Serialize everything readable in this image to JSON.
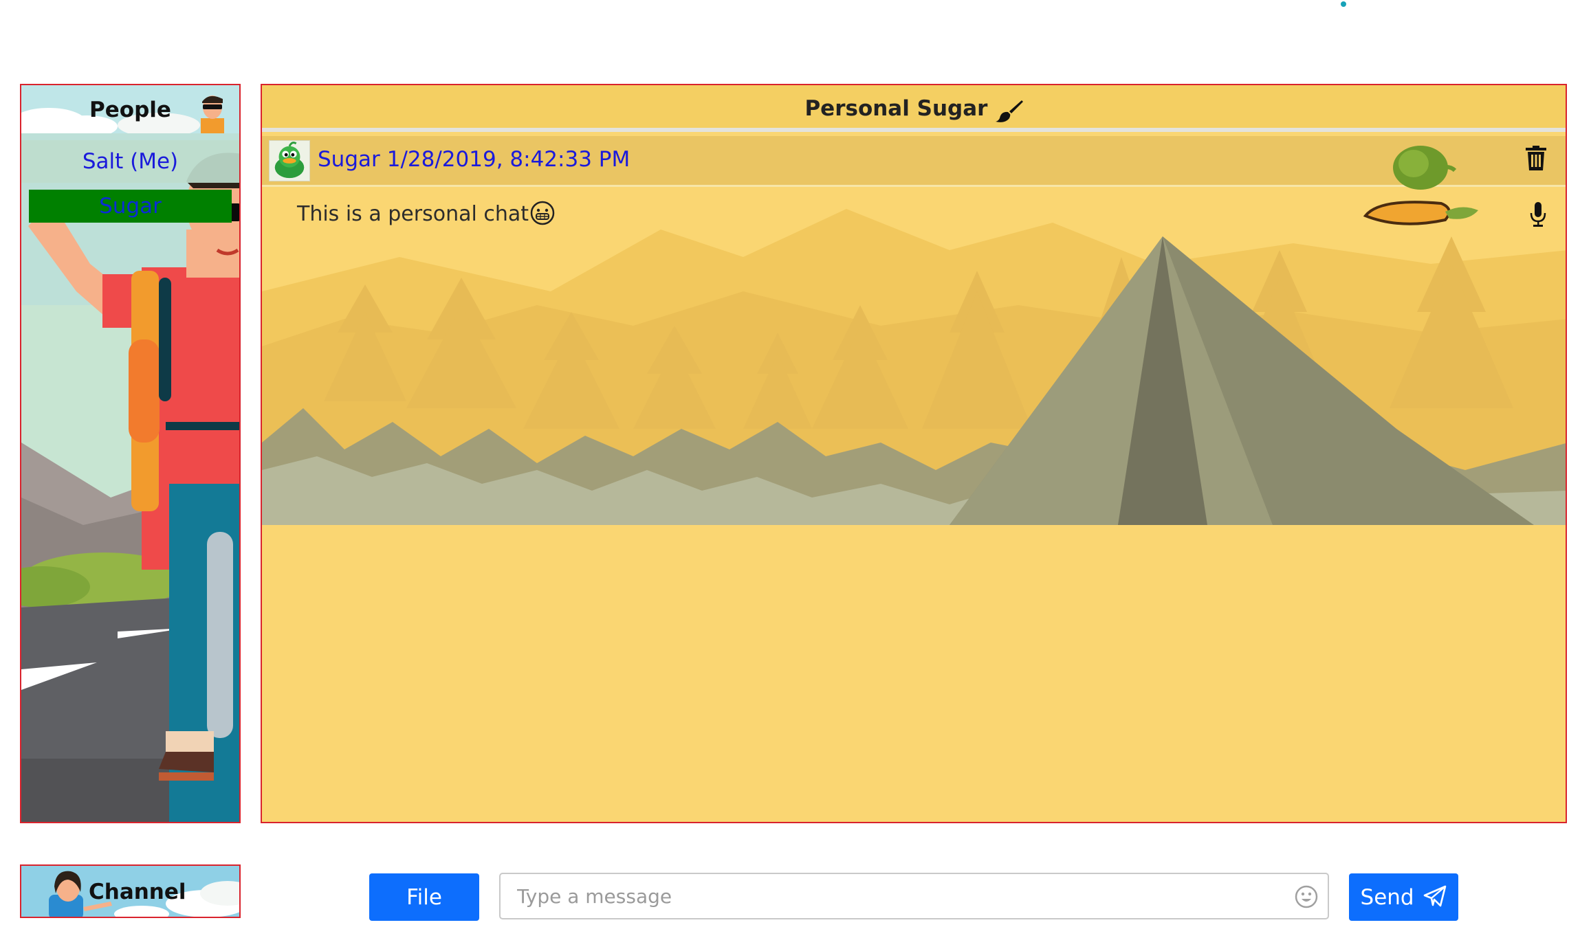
{
  "people_panel": {
    "title": "People",
    "items": [
      {
        "label": "Salt (Me)"
      },
      {
        "label": "Sugar"
      }
    ]
  },
  "chat": {
    "title": "Personal Sugar",
    "messages": [
      {
        "author": "Sugar",
        "timestamp": "1/28/2019, 8:42:33 PM",
        "text": "This is a personal chat"
      }
    ]
  },
  "channel": {
    "label": "Channel"
  },
  "composer": {
    "file_label": "File",
    "input_placeholder": "Type a message",
    "input_value": "",
    "send_label": "Send"
  },
  "icons": {
    "title_icon": "paintbrush-icon",
    "delete": "trash-icon",
    "voice": "microphone-icon",
    "emoji_button": "smiley-icon",
    "send": "paper-plane-icon"
  },
  "colors": {
    "panel_border": "#d9232d",
    "selected_person_bg": "#008000",
    "link_text": "#1a1adb",
    "button_primary": "#0d6efd",
    "chat_background": "#fad672"
  }
}
